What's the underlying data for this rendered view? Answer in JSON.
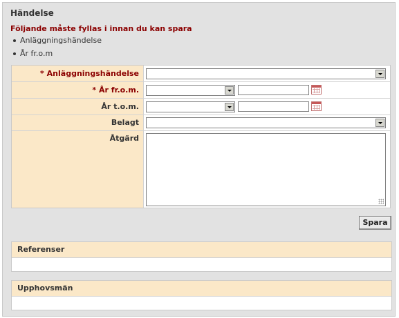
{
  "panel": {
    "title": "Händelse"
  },
  "validation": {
    "title": "Följande måste fyllas i innan du kan spara",
    "items": [
      "Anläggningshändelse",
      "År fr.o.m"
    ]
  },
  "form": {
    "anlaggningshandelse": {
      "label": "Anläggningshändelse",
      "required_mark": "*",
      "value": ""
    },
    "ar_from": {
      "label": "År fr.o.m.",
      "required_mark": "*",
      "select_value": "",
      "date_value": ""
    },
    "ar_tom": {
      "label": "År t.o.m.",
      "select_value": "",
      "date_value": ""
    },
    "belagt": {
      "label": "Belagt",
      "value": ""
    },
    "atgard": {
      "label": "Åtgärd",
      "value": ""
    }
  },
  "actions": {
    "save_label": "Spara"
  },
  "sections": {
    "referenser": {
      "title": "Referenser"
    },
    "upphovsman": {
      "title": "Upphovsmän"
    }
  },
  "colors": {
    "label_bg": "#fbe8c8",
    "panel_bg": "#e2e2e2",
    "required": "#8b0000"
  },
  "icons": {
    "date_picker": "calendar-icon",
    "dropdown": "chevron-down-icon",
    "resize": "resize-grip-icon"
  }
}
